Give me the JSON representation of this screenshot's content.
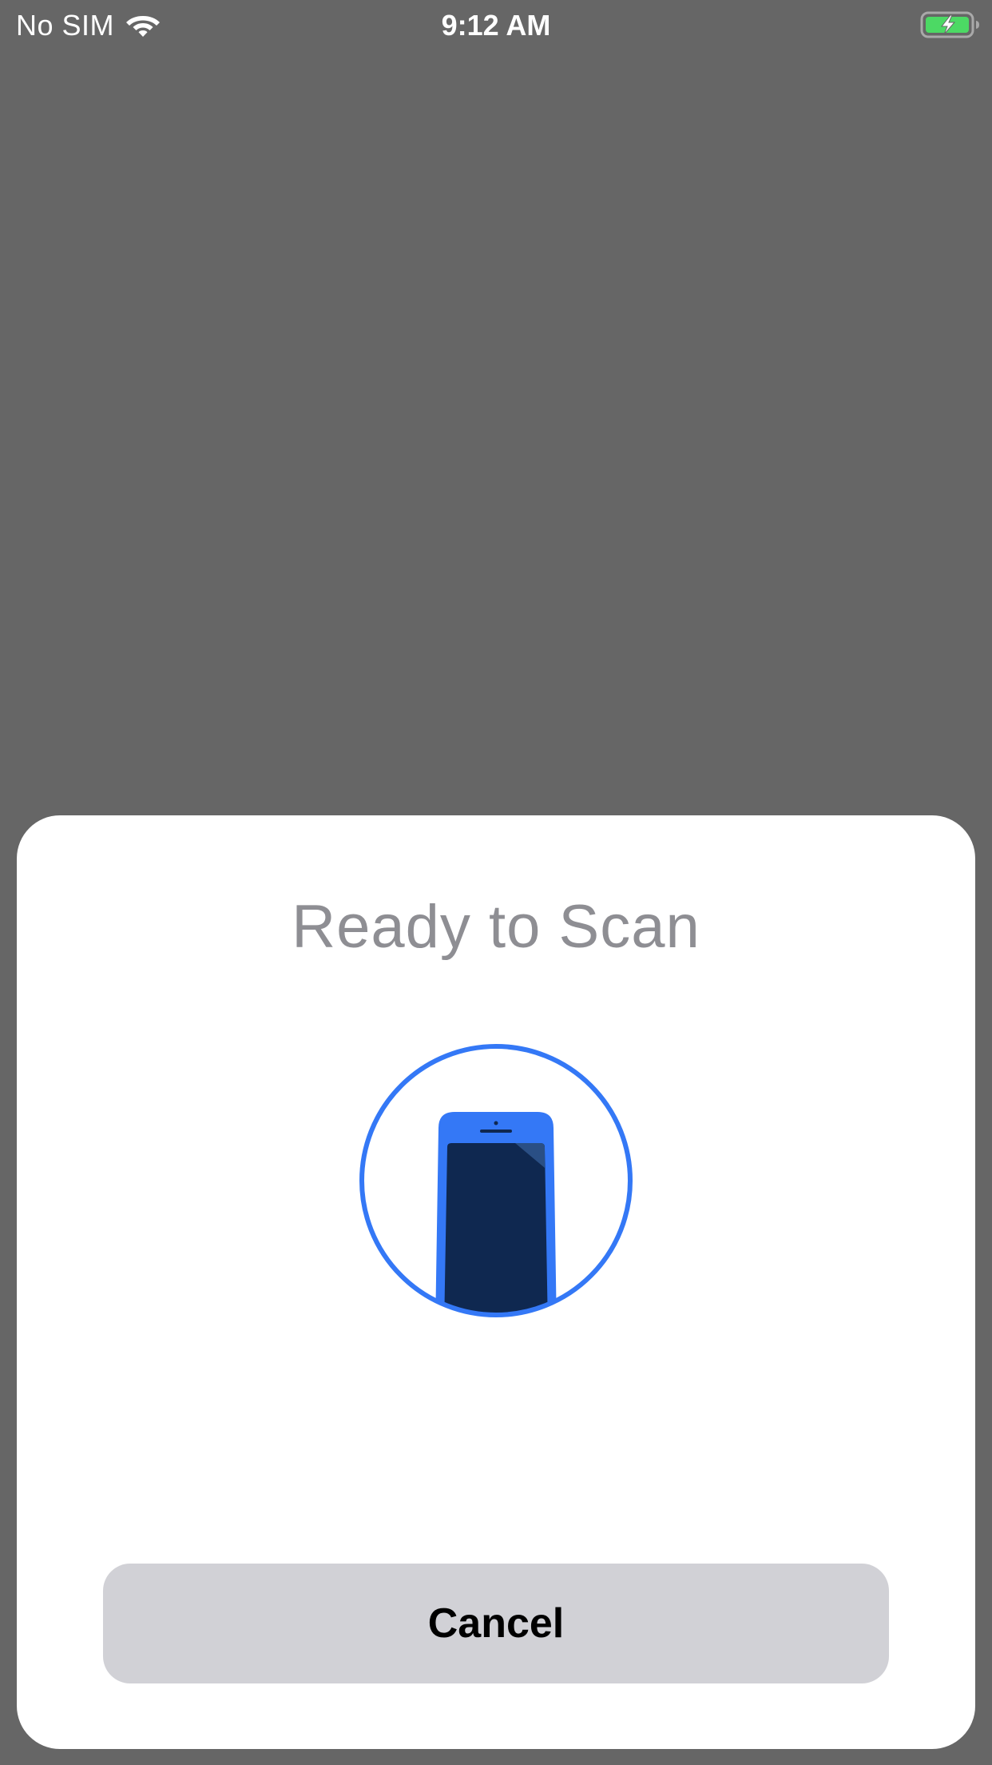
{
  "status_bar": {
    "carrier": "No SIM",
    "time": "9:12 AM",
    "wifi_icon": "wifi-icon",
    "battery_icon": "battery-charging-icon",
    "battery_color": "#4cd964"
  },
  "nfc_sheet": {
    "title": "Ready to Scan",
    "illustration_icon": "phone-scan-icon",
    "cancel_label": "Cancel",
    "accent_color": "#3478f6",
    "phone_screen_color": "#0f2850"
  }
}
